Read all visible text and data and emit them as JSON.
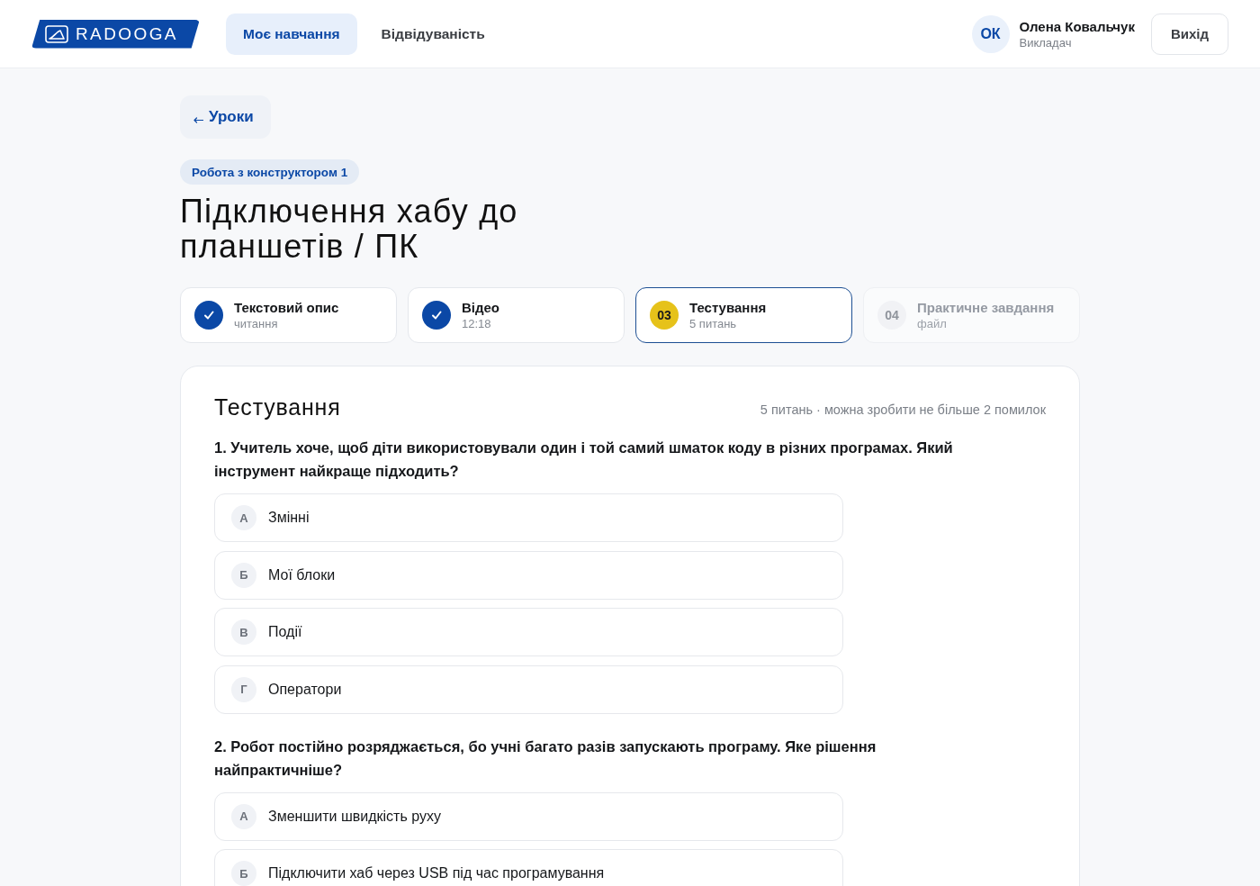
{
  "header": {
    "logo": "RADOOGA",
    "nav": [
      {
        "label": "Моє навчання",
        "selected": true
      },
      {
        "label": "Відвідуваність",
        "selected": false
      }
    ],
    "user": {
      "initials": "ОК",
      "name": "Олена Ковальчук",
      "role": "Викладач"
    },
    "logout": "Вихід"
  },
  "back_link": "Уроки",
  "lesson": {
    "tag": "Робота з конструктором 1",
    "title": "Підключення хабу до планшетів / ПК"
  },
  "steps": [
    {
      "title": "Текстовий опис",
      "subtitle": "читання",
      "done": true,
      "selected": false,
      "disabled": false
    },
    {
      "title": "Відео",
      "subtitle": "12:18",
      "done": true,
      "selected": false,
      "disabled": false
    },
    {
      "title": "Тестування",
      "subtitle": "5 питань",
      "number": "03",
      "done": false,
      "selected": true,
      "disabled": false
    },
    {
      "title": "Практичне завдання",
      "subtitle": "файл",
      "number": "04",
      "done": false,
      "selected": false,
      "disabled": true
    }
  ],
  "quiz": {
    "title": "Тестування",
    "meta": "5 питань · можна зробити не більше 2 помилок",
    "questions": [
      {
        "text": "1. Учитель хоче, щоб діти використовували один і той самий шматок коду в різних програмах. Який інструмент найкраще підходить?",
        "options": [
          {
            "letter": "А",
            "text": "Змінні",
            "selected": false
          },
          {
            "letter": "Б",
            "text": "Мої блоки",
            "selected": false
          },
          {
            "letter": "В",
            "text": "Події",
            "selected": false
          },
          {
            "letter": "Г",
            "text": "Оператори",
            "selected": false
          }
        ]
      },
      {
        "text": "2. Робот постійно розряджається, бо учні багато разів запускають програму. Яке рішення найпрактичніше?",
        "options": [
          {
            "letter": "А",
            "text": "Зменшити швидкість руху",
            "selected": false
          },
          {
            "letter": "Б",
            "text": "Підключити хаб через USB під час програмування",
            "selected": false
          }
        ]
      }
    ]
  }
}
